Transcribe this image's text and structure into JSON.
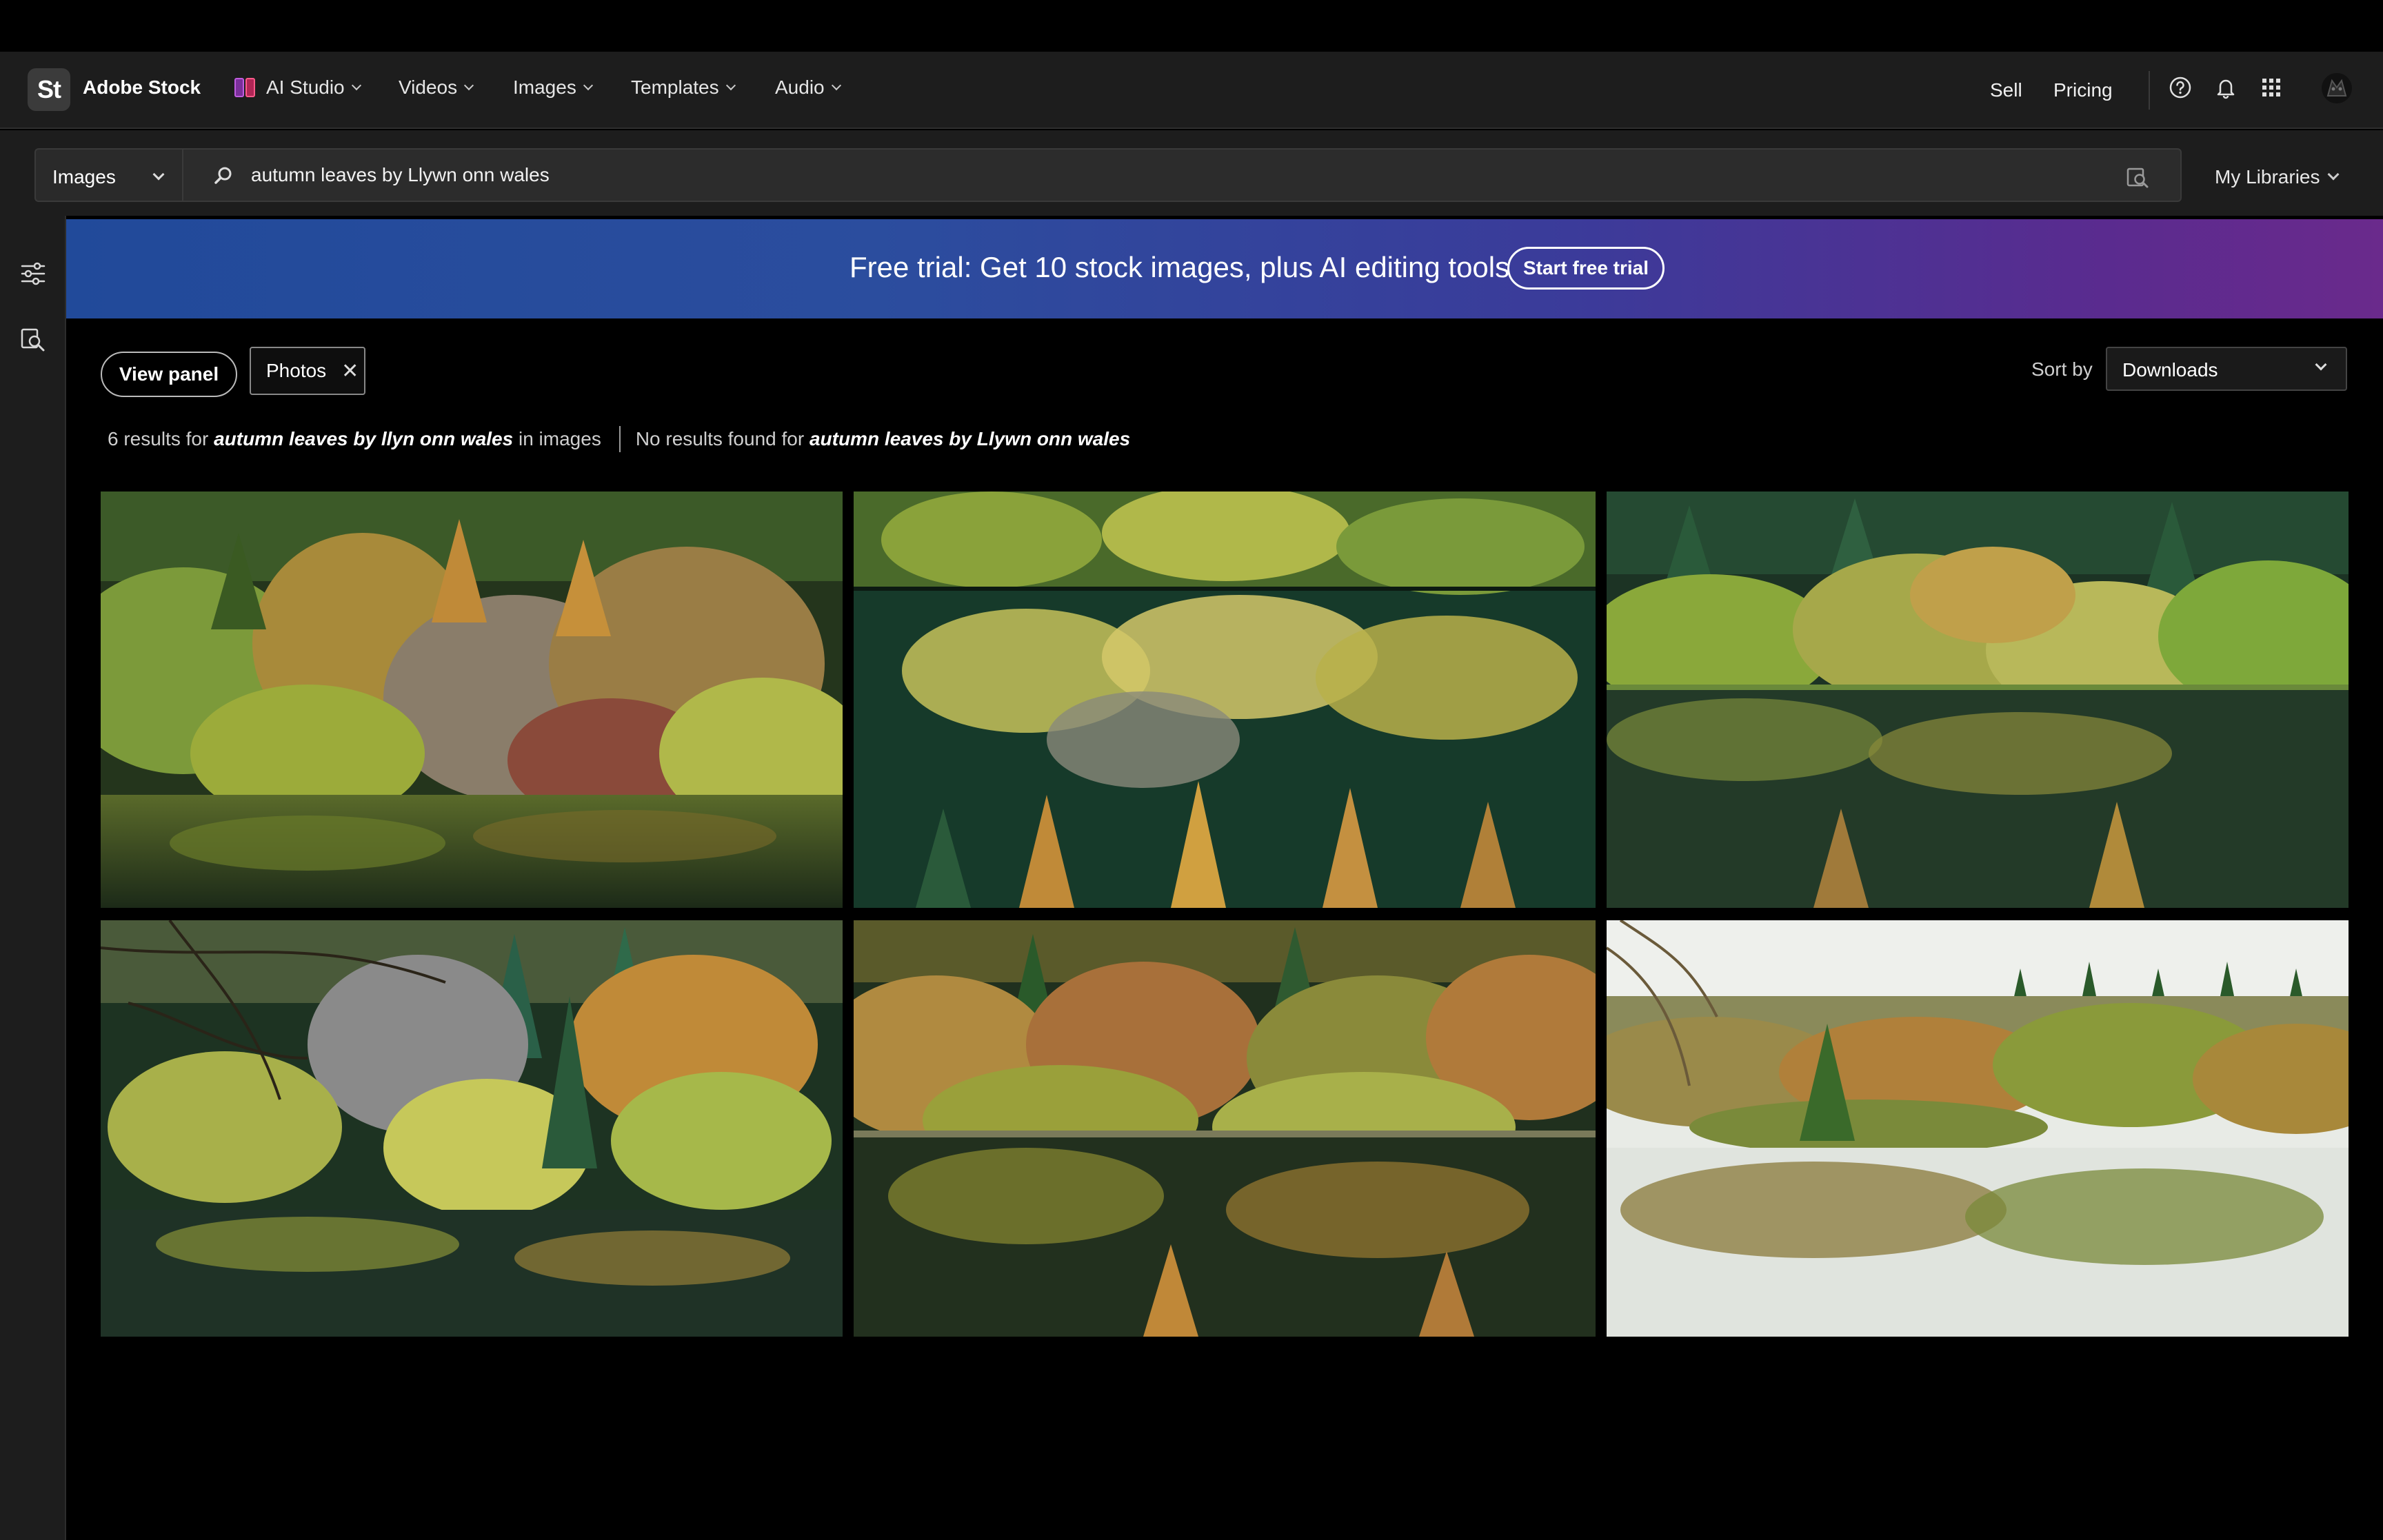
{
  "app": {
    "logo_text": "St",
    "brand": "Adobe Stock"
  },
  "nav": {
    "items": [
      {
        "label": "AI Studio",
        "icon": "ai-studio-icon"
      },
      {
        "label": "Videos"
      },
      {
        "label": "Images"
      },
      {
        "label": "Templates"
      },
      {
        "label": "Audio"
      }
    ],
    "sell": "Sell",
    "pricing": "Pricing",
    "icons": [
      "help-icon",
      "bell-icon",
      "apps-grid-icon",
      "avatar"
    ]
  },
  "search": {
    "scope": "Images",
    "query": "autumn leaves by Llywn onn wales",
    "my_libraries": "My Libraries"
  },
  "banner": {
    "text": "Free trial: Get 10 stock images, plus AI editing tools",
    "button": "Start free trial"
  },
  "filters": {
    "view_panel": "View panel",
    "chip": "Photos",
    "sort_label": "Sort by",
    "sort_value": "Downloads"
  },
  "results": {
    "count_prefix": "6 results for",
    "corrected_query": "autumn leaves by llyn onn wales",
    "count_suffix": "in images",
    "no_results_prefix": "No results found for",
    "original_query": "autumn leaves by Llywn onn wales"
  },
  "images": [
    {
      "name": "autumn-lake-forest-1"
    },
    {
      "name": "autumn-lake-reflection-2"
    },
    {
      "name": "autumn-lake-forest-3"
    },
    {
      "name": "autumn-branches-lake-4"
    },
    {
      "name": "autumn-lake-forest-5"
    },
    {
      "name": "autumn-lake-forest-6"
    }
  ],
  "colors": {
    "header_bg": "#1d1d1d",
    "banner_start": "#214a9a",
    "banner_end": "#6a2a8c",
    "page_bg": "#000000"
  }
}
